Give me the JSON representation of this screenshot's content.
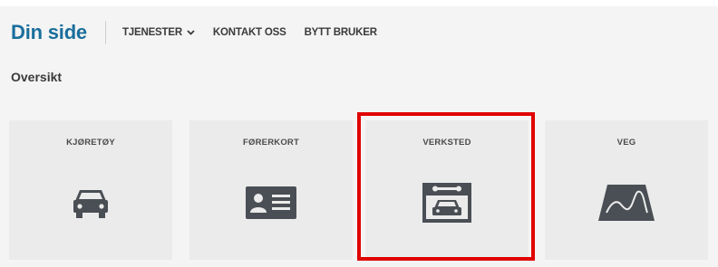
{
  "header": {
    "brand": "Din side",
    "nav": {
      "services": "TJENESTER",
      "contact": "KONTAKT OSS",
      "switch_user": "BYTT BRUKER"
    }
  },
  "main": {
    "section_title": "Oversikt",
    "tiles": [
      {
        "label": "KJØRETØY",
        "icon": "car-icon"
      },
      {
        "label": "FØRERKORT",
        "icon": "id-card-icon"
      },
      {
        "label": "VERKSTED",
        "icon": "workshop-icon"
      },
      {
        "label": "VEG",
        "icon": "road-icon"
      }
    ]
  },
  "colors": {
    "brand": "#1a6e9c",
    "highlight": "#e00000",
    "tile_bg": "#ebebeb",
    "icon": "#4a4f55"
  }
}
